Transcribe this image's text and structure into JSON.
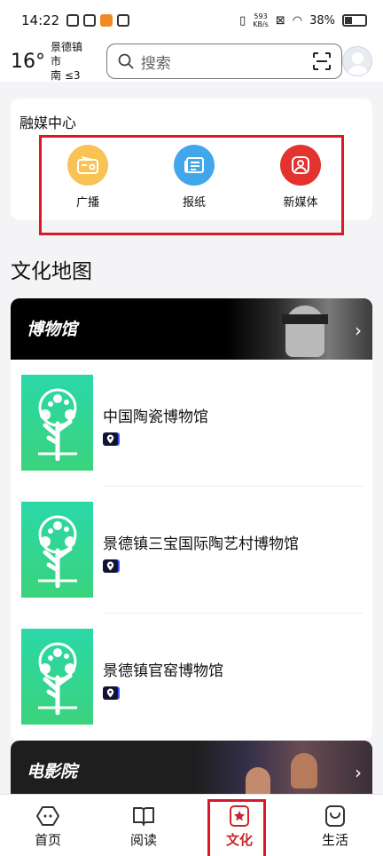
{
  "status_bar": {
    "time": "14:22",
    "net_speed_value": "593",
    "net_speed_unit": "KB/s",
    "battery": "38%"
  },
  "header": {
    "weather_temp": "16°",
    "weather_city": "景德镇市",
    "weather_wind": "南  ≤3",
    "search_placeholder": "搜索"
  },
  "media_center": {
    "title": "融媒中心",
    "items": [
      {
        "label": "广播",
        "icon": "radio-icon",
        "color": "#f8c255"
      },
      {
        "label": "报纸",
        "icon": "newspaper-icon",
        "color": "#41a6ea"
      },
      {
        "label": "新媒体",
        "icon": "new-media-icon",
        "color": "#e2332e"
      }
    ]
  },
  "culture_map": {
    "title": "文化地图",
    "museums_category": "博物馆",
    "museums": [
      {
        "name": "中国陶瓷博物馆"
      },
      {
        "name": "景德镇三宝国际陶艺村博物馆"
      },
      {
        "name": "景德镇官窑博物馆"
      }
    ],
    "cinema_category": "电影院"
  },
  "tabbar": {
    "tabs": [
      {
        "label": "首页",
        "icon": "home-icon"
      },
      {
        "label": "阅读",
        "icon": "book-icon"
      },
      {
        "label": "文化",
        "icon": "culture-star-icon",
        "active": true
      },
      {
        "label": "生活",
        "icon": "shopping-bag-icon"
      }
    ]
  },
  "colors": {
    "accent": "#c62828",
    "highlight_box": "#d9192a"
  }
}
